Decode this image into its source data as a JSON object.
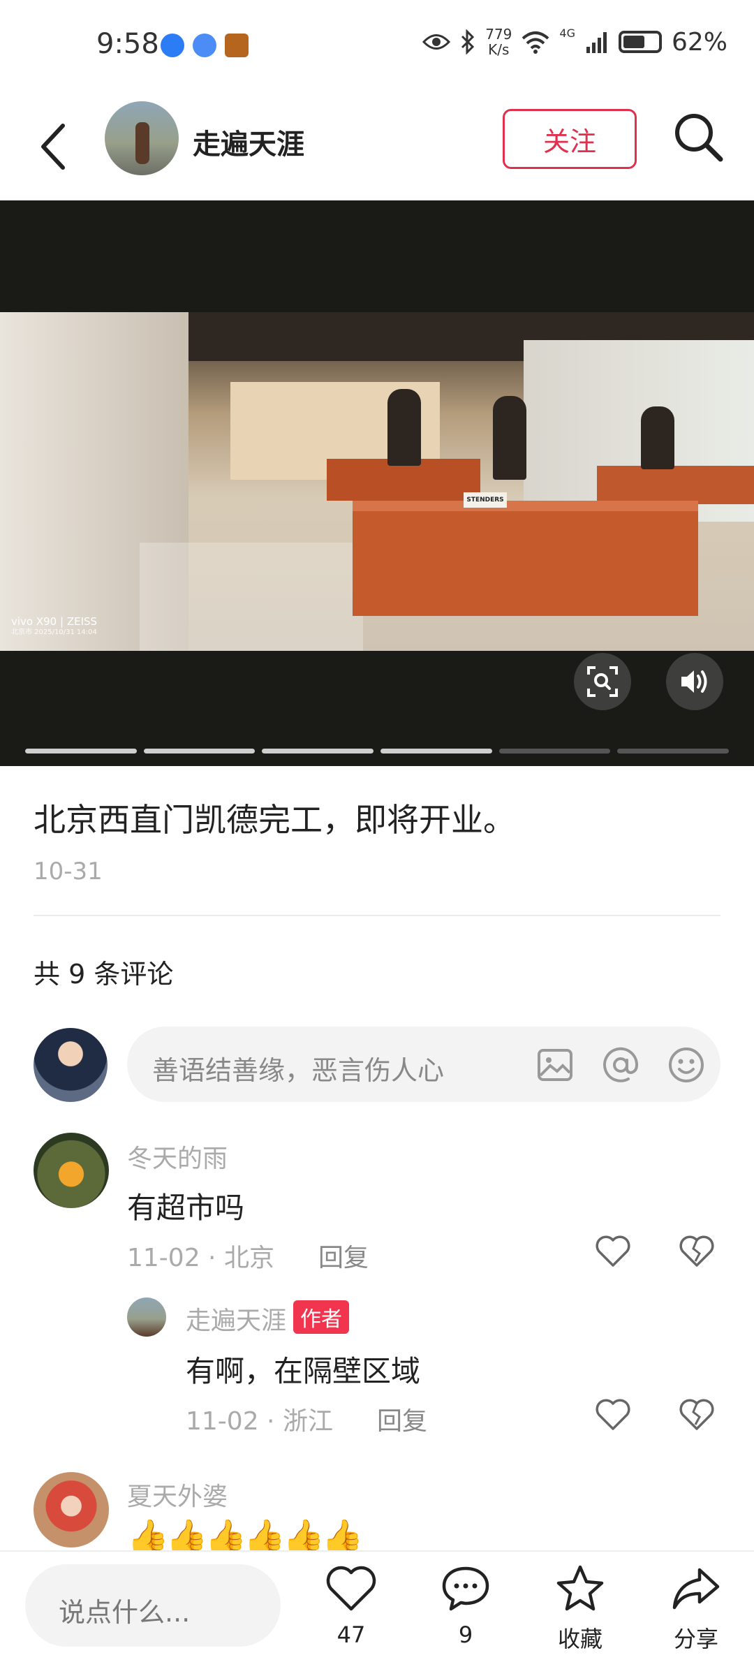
{
  "status_bar": {
    "time": "9:58",
    "net_speed_value": "779",
    "net_speed_unit": "K/s",
    "signal_label": "4G",
    "battery": "62%"
  },
  "header": {
    "author_name": "走遍天涯",
    "follow_label": "关注"
  },
  "media": {
    "watermark_brand": "vivo X90 | ZEISS",
    "watermark_meta": "北京市  2025/10/31 14:04",
    "sign_text": "STENDERS",
    "progress_total": 6,
    "progress_done": 4
  },
  "post": {
    "caption": "北京西直门凯德完工，即将开业。",
    "date": "10-31"
  },
  "comments": {
    "count_label": "共 9 条评论",
    "input_placeholder": "善语结善缘，恶言伤人心",
    "items": [
      {
        "name": "冬天的雨",
        "text": "有超市吗",
        "meta": "11-02 · 北京",
        "reply": "回复"
      },
      {
        "name": "走遍天涯",
        "badge": "作者",
        "text": "有啊，在隔壁区域",
        "meta": "11-02 · 浙江",
        "reply": "回复"
      },
      {
        "name": "夏天外婆",
        "text": "👍👍👍👍👍👍"
      }
    ]
  },
  "bottom_bar": {
    "input_placeholder": "说点什么...",
    "likes": "47",
    "comments": "9",
    "collect_label": "收藏",
    "share_label": "分享"
  },
  "colors": {
    "accent": "#e0304e",
    "badge": "#f2354f",
    "media_bg": "#1a1a17"
  }
}
